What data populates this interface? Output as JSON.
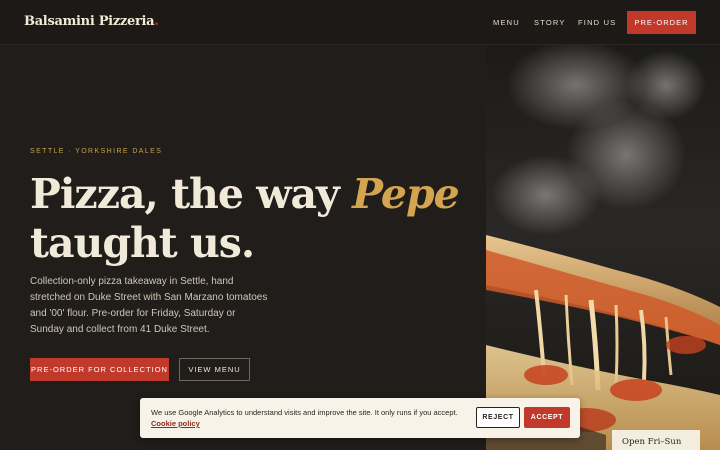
{
  "header": {
    "logo": "Balsamini Pizzeria",
    "logo_dot": ".",
    "nav": [
      "MENU",
      "STORY",
      "FIND US"
    ],
    "cta": "PRE-ORDER"
  },
  "hero": {
    "eyebrow": "SETTLE · YORKSHIRE DALES",
    "headline_part1": "Pizza, the way ",
    "headline_accent": "Pepe",
    "headline_part2": "taught us.",
    "lead": "Collection-only pizza takeaway in Settle, hand stretched on Duke Street with San Marzano tomatoes and '00' flour. Pre-order for Friday, Saturday or Sunday and collect from 41 Duke Street.",
    "primary_button": "PRE-ORDER FOR COLLECTION",
    "secondary_button": "VIEW MENU"
  },
  "hours_card": {
    "title": "Open Fri–Sun"
  },
  "cookie": {
    "text": "We use Google Analytics to understand visits and improve the site. It only runs if you accept.",
    "link": "Cookie policy",
    "reject": "REJECT",
    "accept": "ACCEPT"
  },
  "colors": {
    "background": "#201d1a",
    "accent_red": "#c0392b",
    "accent_gold": "#d4a450",
    "cream": "#f2ead9"
  }
}
